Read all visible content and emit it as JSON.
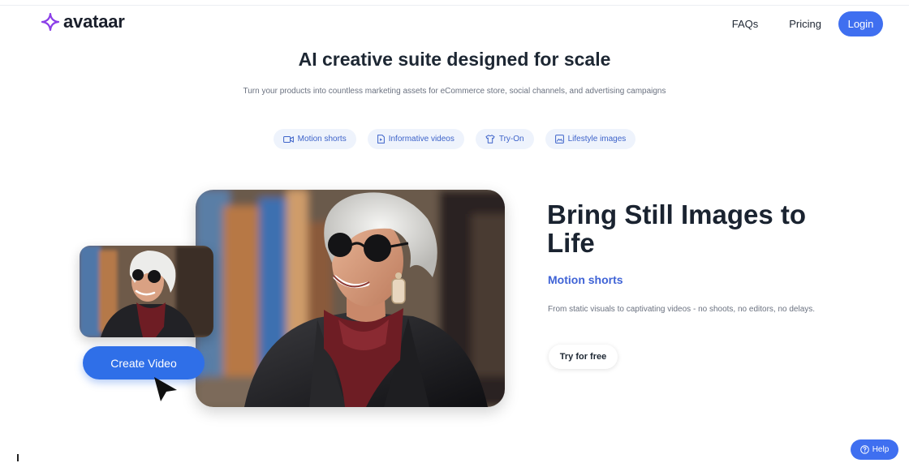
{
  "brand": {
    "name": "avataar",
    "accent": "#8b3fe8"
  },
  "nav": {
    "faqs": "FAQs",
    "pricing": "Pricing",
    "login": "Login"
  },
  "hero": {
    "title": "AI creative suite designed for scale",
    "subtitle": "Turn your products into countless marketing assets for eCommerce store, social channels, and advertising campaigns"
  },
  "tabs": [
    {
      "label": "Motion shorts",
      "icon": "video-icon"
    },
    {
      "label": "Informative videos",
      "icon": "document-icon"
    },
    {
      "label": "Try-On",
      "icon": "shirt-icon"
    },
    {
      "label": "Lifestyle images",
      "icon": "image-icon"
    }
  ],
  "showcase": {
    "create_button": "Create Video",
    "title": "Bring Still Images to Life",
    "label": "Motion shorts",
    "description": "From static visuals to captivating videos - no shoots, no editors, no delays.",
    "cta": "Try for free"
  },
  "help": {
    "label": "Help"
  },
  "colors": {
    "primary": "#3f6ff0",
    "tab_bg": "#eef3fc",
    "tab_text": "#3d63c9"
  }
}
